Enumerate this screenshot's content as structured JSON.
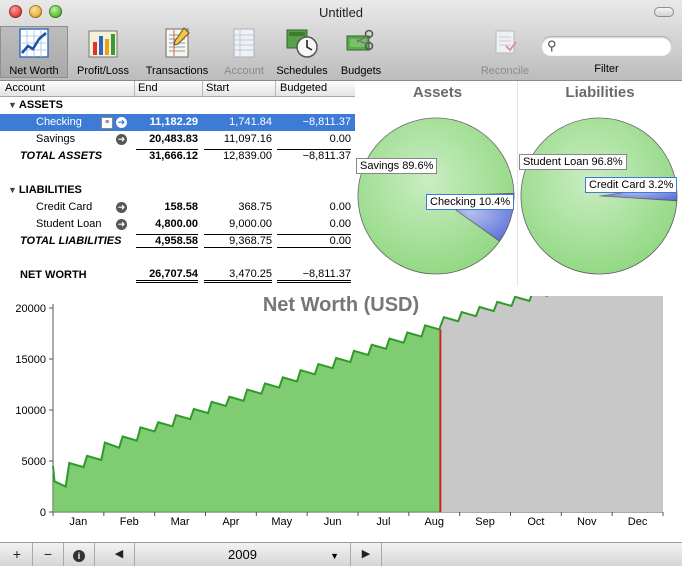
{
  "window": {
    "title": "Untitled"
  },
  "toolbar": {
    "items": [
      {
        "label": "Net Worth",
        "icon": "net-worth-chart-icon",
        "selected": true,
        "enabled": true
      },
      {
        "label": "Profit/Loss",
        "icon": "bar-chart-icon",
        "enabled": true
      },
      {
        "label": "Transactions",
        "icon": "ledger-icon",
        "enabled": true
      },
      {
        "label": "Account",
        "icon": "account-sheet-icon",
        "enabled": false
      },
      {
        "label": "Schedules",
        "icon": "clock-calendar-icon",
        "enabled": true
      },
      {
        "label": "Budgets",
        "icon": "scissors-money-icon",
        "enabled": true
      },
      {
        "label": "Reconcile",
        "icon": "reconcile-icon",
        "enabled": false
      }
    ],
    "filter": {
      "label": "Filter",
      "placeholder": ""
    }
  },
  "table": {
    "headers": [
      "Account",
      "End",
      "Start",
      "Budgeted"
    ],
    "assets_group": "ASSETS",
    "liabilities_group": "LIABILITIES",
    "rows": {
      "checking": {
        "name": "Checking",
        "end": "11,182.29",
        "start": "1,741.84",
        "budgeted": "−8,811.37"
      },
      "savings": {
        "name": "Savings",
        "end": "20,483.83",
        "start": "11,097.16",
        "budgeted": "0.00"
      },
      "total_assets": {
        "name": "TOTAL ASSETS",
        "end": "31,666.12",
        "start": "12,839.00",
        "budgeted": "−8,811.37"
      },
      "credit_card": {
        "name": "Credit Card",
        "end": "158.58",
        "start": "368.75",
        "budgeted": "0.00"
      },
      "student_loan": {
        "name": "Student Loan",
        "end": "4,800.00",
        "start": "9,000.00",
        "budgeted": "0.00"
      },
      "total_liabilities": {
        "name": "TOTAL LIABILITIES",
        "end": "4,958.58",
        "start": "9,368.75",
        "budgeted": "0.00"
      },
      "net_worth": {
        "name": "NET WORTH",
        "end": "26,707.54",
        "start": "3,470.25",
        "budgeted": "−8,811.37"
      }
    }
  },
  "chart_data": [
    {
      "type": "pie",
      "title": "Assets",
      "slices": [
        {
          "label": "Savings 89.6%",
          "value": 89.6,
          "color": "#8ad67a"
        },
        {
          "label": "Checking 10.4%",
          "value": 10.4,
          "color": "#5a6fd8"
        }
      ]
    },
    {
      "type": "pie",
      "title": "Liabilities",
      "slices": [
        {
          "label": "Student Loan 96.8%",
          "value": 96.8,
          "color": "#8ad67a"
        },
        {
          "label": "Credit Card 3.2%",
          "value": 3.2,
          "color": "#5a6fd8"
        }
      ]
    },
    {
      "type": "area",
      "title": "Net Worth (USD)",
      "categories": [
        "Jan",
        "Feb",
        "Mar",
        "Apr",
        "May",
        "Jun",
        "Jul",
        "Aug",
        "Sep",
        "Oct",
        "Nov",
        "Dec"
      ],
      "yticks": [
        "0",
        "5000",
        "10000",
        "15000",
        "20000"
      ],
      "ylim": [
        0,
        20000
      ],
      "actual_color": "#55bb44",
      "projected_color": "#c8c8c8",
      "today_marker_color": "#cc2222",
      "today_x": 7.62,
      "series": [
        {
          "values": [
            [
              0.0,
              4500
            ],
            [
              0.03,
              3000
            ],
            [
              0.25,
              2500
            ],
            [
              0.32,
              4800
            ],
            [
              0.6,
              4400
            ],
            [
              0.67,
              5500
            ],
            [
              0.95,
              5100
            ],
            [
              1.02,
              6800
            ],
            [
              1.3,
              6300
            ],
            [
              1.37,
              7400
            ],
            [
              1.65,
              7000
            ],
            [
              1.72,
              8300
            ],
            [
              2.0,
              7900
            ],
            [
              2.07,
              8800
            ],
            [
              2.35,
              8400
            ],
            [
              2.42,
              9500
            ],
            [
              2.7,
              9100
            ],
            [
              2.77,
              10100
            ],
            [
              3.05,
              9700
            ],
            [
              3.12,
              10800
            ],
            [
              3.4,
              10400
            ],
            [
              3.47,
              11300
            ],
            [
              3.75,
              10900
            ],
            [
              3.82,
              12000
            ],
            [
              4.1,
              11600
            ],
            [
              4.17,
              12600
            ],
            [
              4.45,
              12200
            ],
            [
              4.52,
              13200
            ],
            [
              4.8,
              12800
            ],
            [
              4.87,
              13900
            ],
            [
              5.15,
              13500
            ],
            [
              5.22,
              14500
            ],
            [
              5.5,
              14100
            ],
            [
              5.57,
              15100
            ],
            [
              5.85,
              14700
            ],
            [
              5.92,
              15800
            ],
            [
              6.2,
              15400
            ],
            [
              6.27,
              16400
            ],
            [
              6.55,
              16000
            ],
            [
              6.62,
              17000
            ],
            [
              6.9,
              16600
            ],
            [
              6.97,
              17600
            ],
            [
              7.25,
              17200
            ],
            [
              7.32,
              18300
            ],
            [
              7.6,
              17900
            ]
          ]
        },
        {
          "values": [
            [
              0.0,
              5200
            ],
            [
              0.03,
              3600
            ],
            [
              0.25,
              3200
            ],
            [
              0.32,
              5400
            ],
            [
              0.6,
              5000
            ],
            [
              0.67,
              6200
            ],
            [
              0.95,
              5800
            ],
            [
              1.02,
              7400
            ],
            [
              1.3,
              7000
            ],
            [
              1.37,
              8000
            ],
            [
              1.65,
              7600
            ],
            [
              1.72,
              9000
            ],
            [
              2.0,
              8600
            ],
            [
              2.07,
              9600
            ],
            [
              2.35,
              9200
            ],
            [
              2.42,
              10200
            ],
            [
              2.7,
              9800
            ],
            [
              2.77,
              10900
            ],
            [
              3.05,
              10500
            ],
            [
              3.12,
              11500
            ],
            [
              3.4,
              11100
            ],
            [
              3.47,
              12100
            ],
            [
              3.75,
              11700
            ],
            [
              3.82,
              12800
            ],
            [
              4.1,
              12400
            ],
            [
              4.17,
              13400
            ],
            [
              4.45,
              13000
            ],
            [
              4.52,
              14000
            ],
            [
              4.8,
              13600
            ],
            [
              4.87,
              14700
            ],
            [
              5.15,
              14300
            ],
            [
              5.22,
              15300
            ],
            [
              5.5,
              14900
            ],
            [
              5.57,
              16000
            ],
            [
              5.85,
              15600
            ],
            [
              5.92,
              16600
            ],
            [
              6.2,
              16200
            ],
            [
              6.27,
              17200
            ],
            [
              6.55,
              16800
            ],
            [
              6.62,
              17900
            ],
            [
              6.9,
              17500
            ],
            [
              6.97,
              18600
            ],
            [
              7.25,
              18200
            ],
            [
              7.32,
              19300
            ],
            [
              7.6,
              18900
            ]
          ]
        }
      ]
    }
  ],
  "bottombar": {
    "add": "+",
    "remove": "−",
    "info": "i",
    "prev": "◀",
    "next": "▶",
    "year": "2009"
  }
}
